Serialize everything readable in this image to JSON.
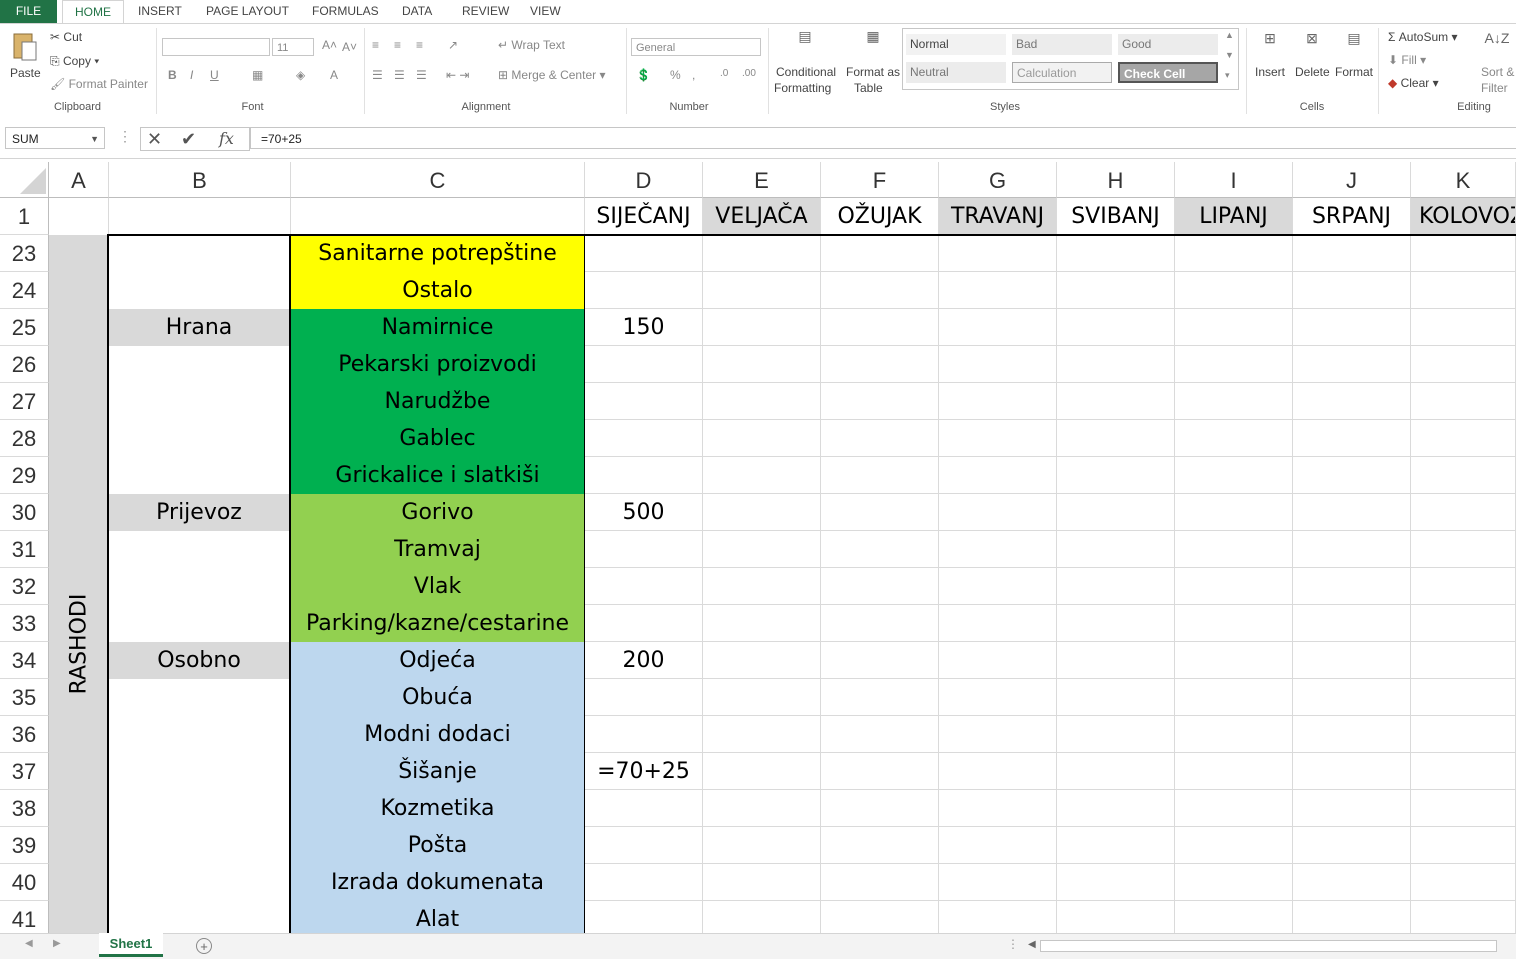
{
  "tabs": [
    "FILE",
    "HOME",
    "INSERT",
    "PAGE LAYOUT",
    "FORMULAS",
    "DATA",
    "REVIEW",
    "VIEW"
  ],
  "clipboard": {
    "paste": "Paste",
    "cut": "Cut",
    "copy": "Copy",
    "format_painter": "Format Painter",
    "label": "Clipboard"
  },
  "font": {
    "size": "11",
    "label": "Font"
  },
  "alignment": {
    "wrap_text": "Wrap Text",
    "merge_center": "Merge & Center",
    "label": "Alignment"
  },
  "number": {
    "format": "General",
    "label": "Number"
  },
  "styles": {
    "conditional_1": "Conditional",
    "conditional_2": "Formatting",
    "format_table_1": "Format as",
    "format_table_2": "Table",
    "normal": "Normal",
    "bad": "Bad",
    "good": "Good",
    "neutral": "Neutral",
    "calculation": "Calculation",
    "check_cell": "Check Cell",
    "label": "Styles"
  },
  "cells": {
    "insert": "Insert",
    "delete": "Delete",
    "format": "Format",
    "label": "Cells"
  },
  "editing": {
    "autosum": "AutoSum",
    "fill": "Fill",
    "clear": "Clear",
    "sort_1": "Sort &",
    "sort_2": "Filter",
    "label": "Editing"
  },
  "formula_bar": {
    "name_box": "SUM",
    "fx": "fx",
    "formula": "=70+25"
  },
  "columns": [
    "A",
    "B",
    "C",
    "D",
    "E",
    "F",
    "G",
    "H",
    "I",
    "J",
    "K"
  ],
  "header_row": {
    "row": "1",
    "months": [
      "SIJEČANJ",
      "VELJAČA",
      "OŽUJAK",
      "TRAVANJ",
      "SVIBANJ",
      "LIPANJ",
      "SRPANJ",
      "KOLOVOZ"
    ]
  },
  "rashodi_label": "RASHODI",
  "rows": [
    {
      "n": "23",
      "b": "",
      "c": "Sanitarne potrepštine",
      "d": ""
    },
    {
      "n": "24",
      "b": "",
      "c": "Ostalo",
      "d": ""
    },
    {
      "n": "25",
      "b": "Hrana",
      "c": "Namirnice",
      "d": "150"
    },
    {
      "n": "26",
      "b": "",
      "c": "Pekarski proizvodi",
      "d": ""
    },
    {
      "n": "27",
      "b": "",
      "c": "Narudžbe",
      "d": ""
    },
    {
      "n": "28",
      "b": "",
      "c": "Gablec",
      "d": ""
    },
    {
      "n": "29",
      "b": "",
      "c": "Grickalice i slatkiši",
      "d": ""
    },
    {
      "n": "30",
      "b": "Prijevoz",
      "c": "Gorivo",
      "d": "500"
    },
    {
      "n": "31",
      "b": "",
      "c": "Tramvaj",
      "d": ""
    },
    {
      "n": "32",
      "b": "",
      "c": "Vlak",
      "d": ""
    },
    {
      "n": "33",
      "b": "",
      "c": "Parking/kazne/cestarine",
      "d": ""
    },
    {
      "n": "34",
      "b": "Osobno",
      "c": "Odjeća",
      "d": "200"
    },
    {
      "n": "35",
      "b": "",
      "c": "Obuća",
      "d": ""
    },
    {
      "n": "36",
      "b": "",
      "c": "Modni dodaci",
      "d": ""
    },
    {
      "n": "37",
      "b": "",
      "c": "Šišanje",
      "d": "=70+25"
    },
    {
      "n": "38",
      "b": "",
      "c": "Kozmetika",
      "d": ""
    },
    {
      "n": "39",
      "b": "",
      "c": "Pošta",
      "d": ""
    },
    {
      "n": "40",
      "b": "",
      "c": "Izrada dokumenata",
      "d": ""
    },
    {
      "n": "41",
      "b": "",
      "c": "Alat",
      "d": ""
    }
  ],
  "colors": {
    "yellow": "#ffff00",
    "dark_green": "#00b050",
    "light_green": "#92d050",
    "light_blue": "#bdd7ee",
    "gray": "#d9d9d9",
    "excel_green": "#217346"
  },
  "sheet_tab": "Sheet1"
}
